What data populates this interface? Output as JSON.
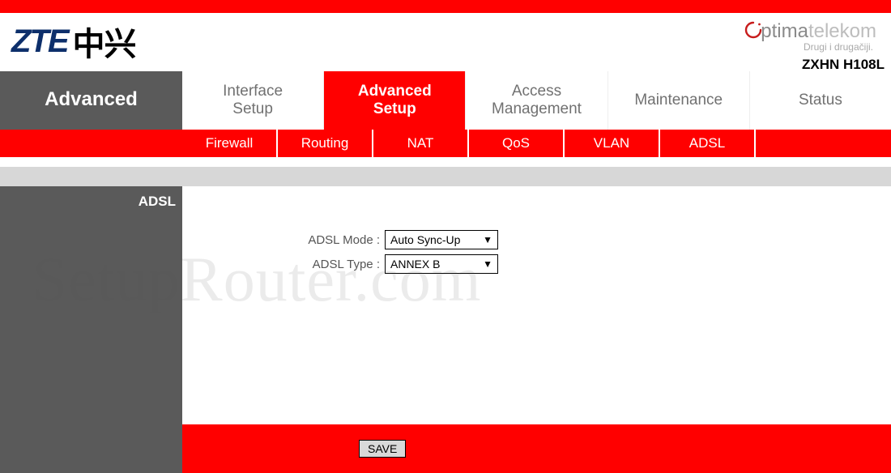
{
  "brand": {
    "zte_en": "ZTE",
    "zte_cn": "中兴",
    "optima_1": "ptima",
    "optima_2": "telekom",
    "tagline": "Drugi i drugačiji.",
    "model": "ZXHN H108L"
  },
  "page": {
    "title": "Advanced"
  },
  "tabs": {
    "items": [
      {
        "label_line1": "Interface",
        "label_line2": "Setup",
        "active": false
      },
      {
        "label_line1": "Advanced",
        "label_line2": "Setup",
        "active": true
      },
      {
        "label_line1": "Access",
        "label_line2": "Management",
        "active": false
      },
      {
        "label_line1": "Maintenance",
        "label_line2": "",
        "active": false
      },
      {
        "label_line1": "Status",
        "label_line2": "",
        "active": false
      }
    ]
  },
  "subnav": {
    "items": [
      {
        "label": "Firewall"
      },
      {
        "label": "Routing"
      },
      {
        "label": "NAT"
      },
      {
        "label": "QoS"
      },
      {
        "label": "VLAN"
      },
      {
        "label": "ADSL"
      }
    ]
  },
  "sidebar": {
    "section": "ADSL"
  },
  "form": {
    "adsl_mode_label": "ADSL Mode :",
    "adsl_mode_value": "Auto Sync-Up",
    "adsl_type_label": "ADSL Type :",
    "adsl_type_value": "ANNEX B"
  },
  "footer": {
    "save": "SAVE"
  },
  "watermark": "SetupRouter.com"
}
